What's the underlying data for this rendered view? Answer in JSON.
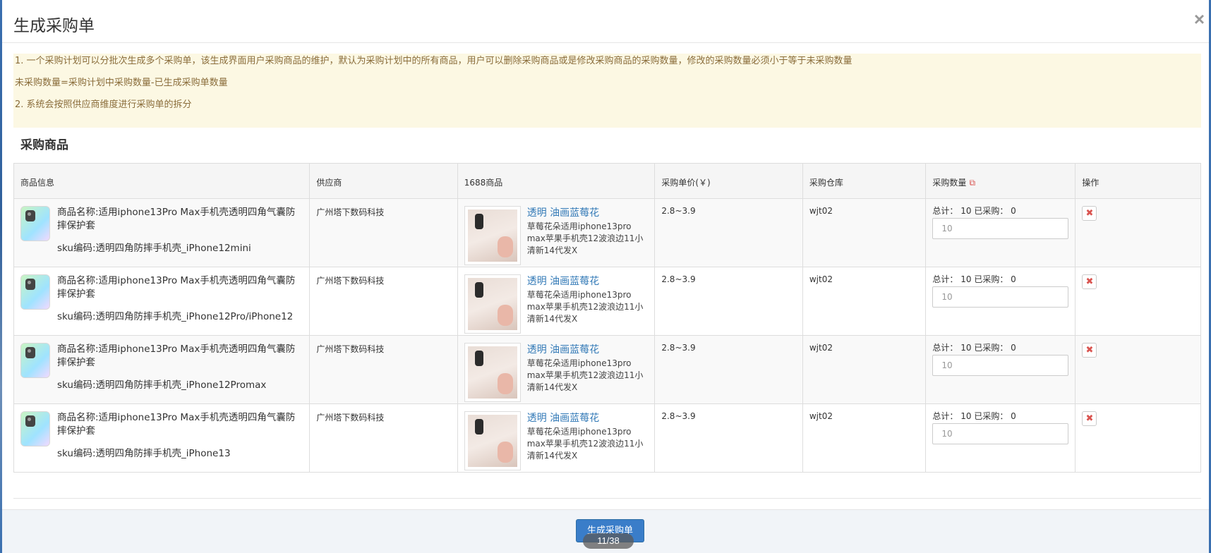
{
  "modal": {
    "title": "生成采购单"
  },
  "notice": {
    "line1": "1. 一个采购计划可以分批次生成多个采购单，该生成界面用户采购商品的维护，默认为采购计划中的所有商品，用户可以删除采购商品或是修改采购商品的采购数量，修改的采购数量必须小于等于未采购数量",
    "line2": "未采购数量=采购计划中采购数量-已生成采购单数量",
    "line3": "2. 系统会按照供应商维度进行采购单的拆分"
  },
  "section_title": "采购商品",
  "table": {
    "headers": {
      "product": "商品信息",
      "supplier": "供应商",
      "ali": "1688商品",
      "price": "采购单价(￥)",
      "warehouse": "采购仓库",
      "qty": "采购数量",
      "ops": "操作"
    },
    "rows": [
      {
        "name": "商品名称:适用iphone13Pro Max手机壳透明四角气囊防摔保护套",
        "sku": "sku编码:透明四角防摔手机壳_iPhone12mini",
        "supplier": "广州塔下数码科技",
        "ali_title": "透明 油画蓝莓花",
        "ali_desc": "草莓花朵适用iphone13pro max苹果手机壳12波浪边11小清新14代发X",
        "price": "2.8~3.9",
        "warehouse": "wjt02",
        "qty_info": "总计： 10 已采购： 0",
        "qty_value": "10"
      },
      {
        "name": "商品名称:适用iphone13Pro Max手机壳透明四角气囊防摔保护套",
        "sku": "sku编码:透明四角防摔手机壳_iPhone12Pro/iPhone12",
        "supplier": "广州塔下数码科技",
        "ali_title": "透明 油画蓝莓花",
        "ali_desc": "草莓花朵适用iphone13pro max苹果手机壳12波浪边11小清新14代发X",
        "price": "2.8~3.9",
        "warehouse": "wjt02",
        "qty_info": "总计： 10 已采购： 0",
        "qty_value": "10"
      },
      {
        "name": "商品名称:适用iphone13Pro Max手机壳透明四角气囊防摔保护套",
        "sku": "sku编码:透明四角防摔手机壳_iPhone12Promax",
        "supplier": "广州塔下数码科技",
        "ali_title": "透明 油画蓝莓花",
        "ali_desc": "草莓花朵适用iphone13pro max苹果手机壳12波浪边11小清新14代发X",
        "price": "2.8~3.9",
        "warehouse": "wjt02",
        "qty_info": "总计： 10 已采购： 0",
        "qty_value": "10"
      },
      {
        "name": "商品名称:适用iphone13Pro Max手机壳透明四角气囊防摔保护套",
        "sku": "sku编码:透明四角防摔手机壳_iPhone13",
        "supplier": "广州塔下数码科技",
        "ali_title": "透明 油画蓝莓花",
        "ali_desc": "草莓花朵适用iphone13pro max苹果手机壳12波浪边11小清新14代发X",
        "price": "2.8~3.9",
        "warehouse": "wjt02",
        "qty_info": "总计： 10 已采购： 0",
        "qty_value": "10"
      }
    ]
  },
  "footer": {
    "submit_label": "生成采购单",
    "pager": "11/38"
  },
  "icons": {
    "close": "close-icon",
    "edit": "edit-icon",
    "delete": "delete-icon"
  }
}
